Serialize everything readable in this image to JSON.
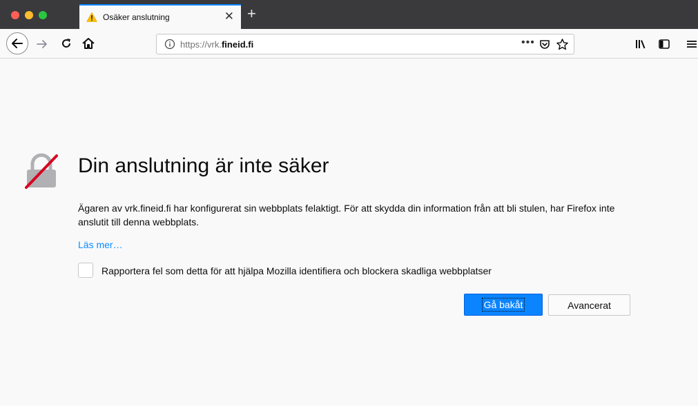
{
  "tab": {
    "title": "Osäker anslutning"
  },
  "toolbar": {
    "url_prefix": "https://vrk.",
    "url_domain": "fineid.fi",
    "url_more": "•••"
  },
  "page": {
    "title": "Din anslutning är inte säker",
    "description": "Ägaren av vrk.fineid.fi har konfigurerat sin webbplats felaktigt. För att skydda din information från att bli stulen, har Firefox inte anslutit till denna webbplats.",
    "learn_more": "Läs mer…",
    "report_checkbox_label": "Rapportera fel som detta för att hjälpa Mozilla identifiera och blockera skadliga webbplatser",
    "go_back_button": "Gå bakåt",
    "advanced_button": "Avancerat"
  },
  "colors": {
    "accent": "#0a84ff",
    "warning": "#d70022",
    "tab_bar": "#3a3a3c"
  }
}
